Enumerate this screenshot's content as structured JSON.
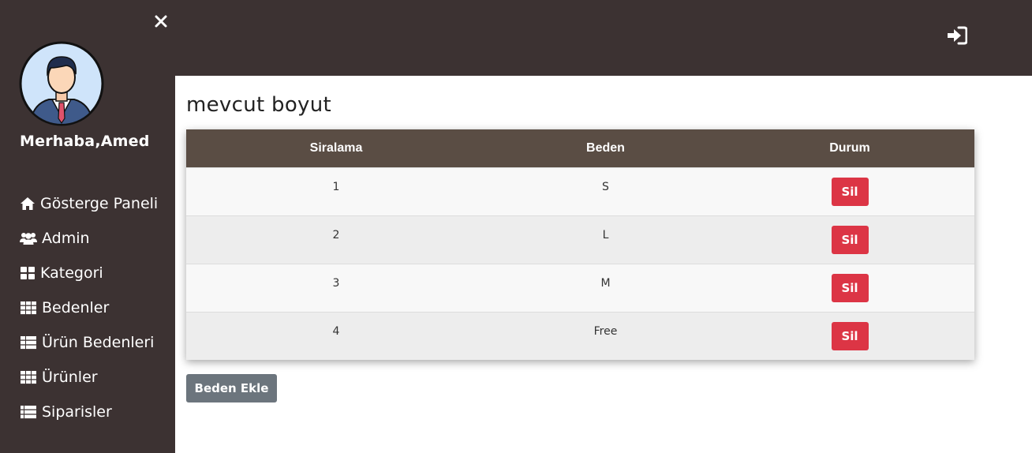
{
  "user": {
    "greeting": "Merhaba,Amed"
  },
  "sidebar": {
    "items": [
      {
        "label": "Gösterge Paneli",
        "icon": "home-icon"
      },
      {
        "label": "Admin",
        "icon": "users-icon"
      },
      {
        "label": "Kategori",
        "icon": "th-large-icon"
      },
      {
        "label": "Bedenler",
        "icon": "th-icon"
      },
      {
        "label": "Ürün Bedenleri",
        "icon": "th-list-icon"
      },
      {
        "label": "Ürünler",
        "icon": "th-icon"
      },
      {
        "label": "Siparisler",
        "icon": "list-icon"
      }
    ]
  },
  "page": {
    "title": "mevcut boyut"
  },
  "table": {
    "headers": [
      "Siralama",
      "Beden",
      "Durum"
    ],
    "rows": [
      {
        "order": "1",
        "size": "S",
        "action": "Sil"
      },
      {
        "order": "2",
        "size": "L",
        "action": "Sil"
      },
      {
        "order": "3",
        "size": "M",
        "action": "Sil"
      },
      {
        "order": "4",
        "size": "Free",
        "action": "Sil"
      }
    ]
  },
  "actions": {
    "add_label": "Beden Ekle"
  },
  "colors": {
    "sidebar_bg": "#3c3232",
    "table_header_bg": "#5a4d44",
    "danger": "#dc3545",
    "secondary": "#6c757d"
  }
}
